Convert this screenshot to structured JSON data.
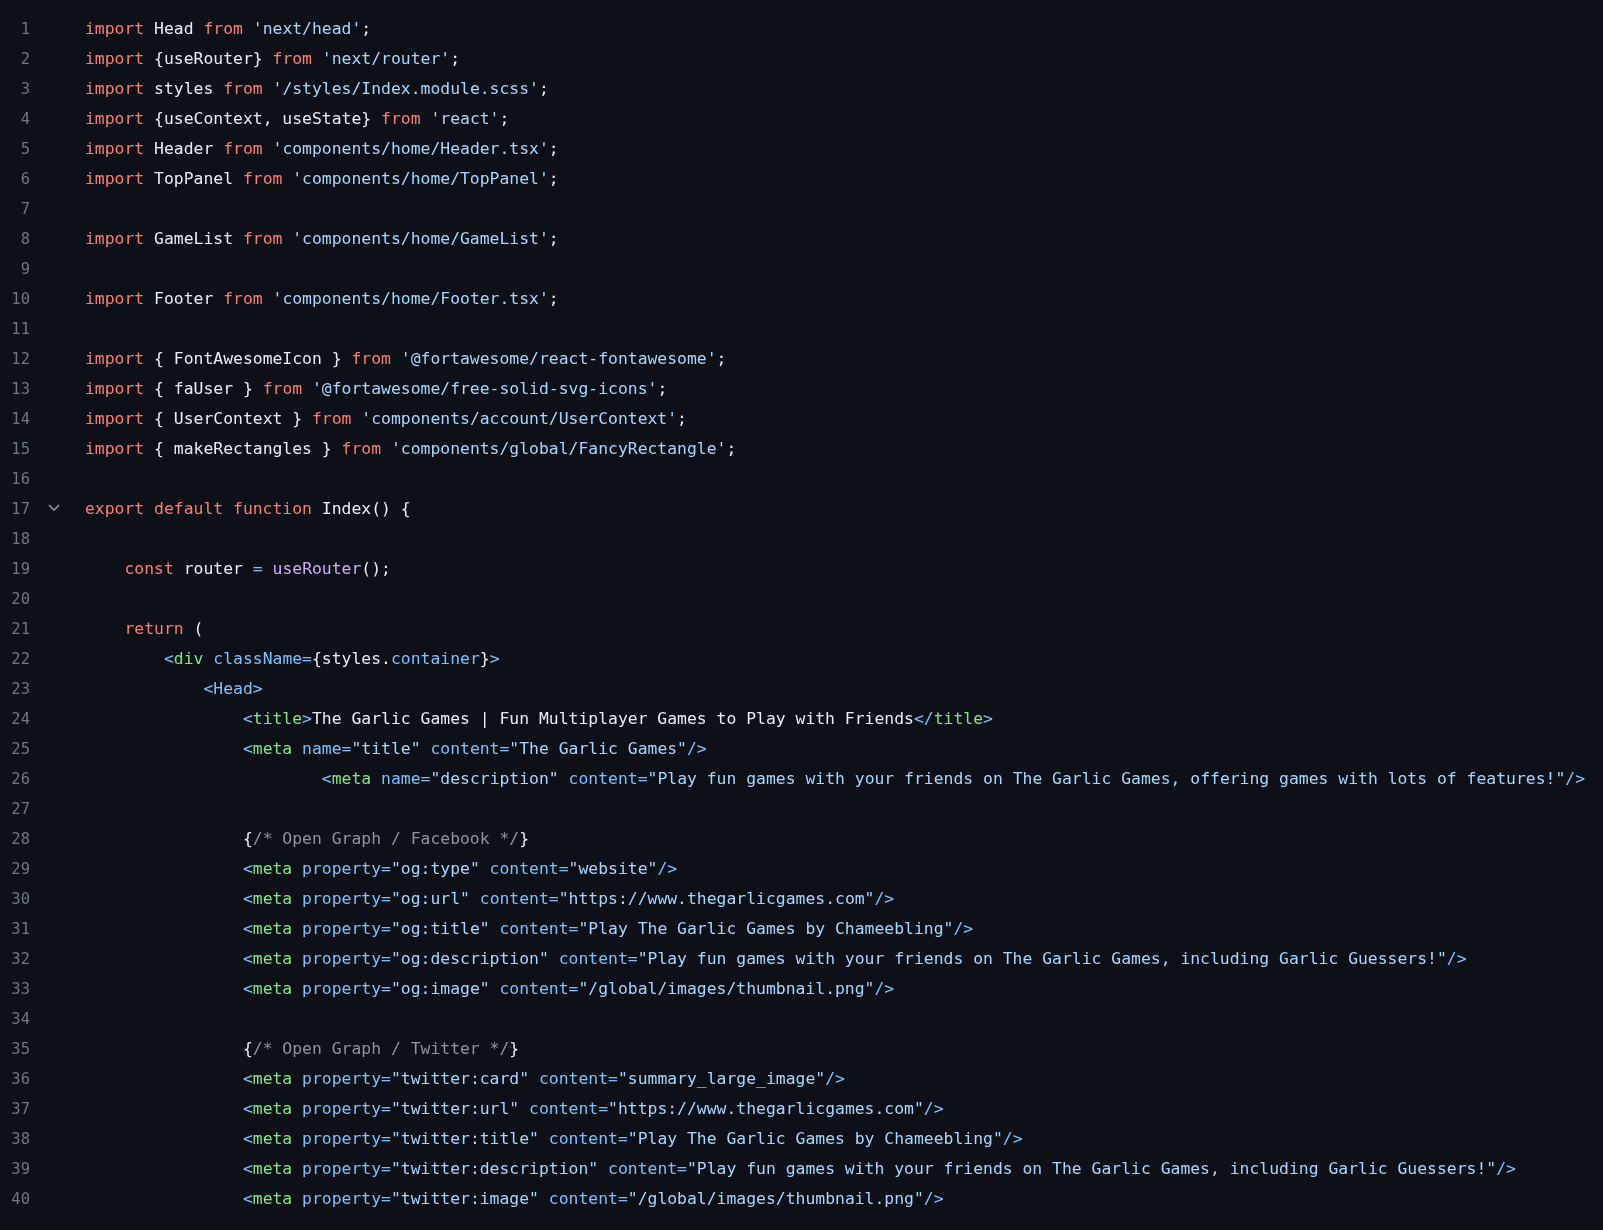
{
  "code_view": {
    "lines": [
      {
        "number": "1",
        "tokens": [
          {
            "kind": "keyword",
            "text": "import"
          },
          {
            "kind": "plain",
            "text": " Head "
          },
          {
            "kind": "keyword",
            "text": "from "
          },
          {
            "kind": "string",
            "text": "'next/head'"
          },
          {
            "kind": "plain",
            "text": ";"
          }
        ]
      },
      {
        "number": "2",
        "tokens": [
          {
            "kind": "keyword",
            "text": "import"
          },
          {
            "kind": "plain",
            "text": " {useRouter} "
          },
          {
            "kind": "keyword",
            "text": "from "
          },
          {
            "kind": "string",
            "text": "'next/router'"
          },
          {
            "kind": "plain",
            "text": ";"
          }
        ]
      },
      {
        "number": "3",
        "tokens": [
          {
            "kind": "keyword",
            "text": "import"
          },
          {
            "kind": "plain",
            "text": " styles "
          },
          {
            "kind": "keyword",
            "text": "from "
          },
          {
            "kind": "string",
            "text": "'/styles/Index.module.scss'"
          },
          {
            "kind": "plain",
            "text": ";"
          }
        ]
      },
      {
        "number": "4",
        "tokens": [
          {
            "kind": "keyword",
            "text": "import"
          },
          {
            "kind": "plain",
            "text": " {useContext, useState} "
          },
          {
            "kind": "keyword",
            "text": "from "
          },
          {
            "kind": "string",
            "text": "'react'"
          },
          {
            "kind": "plain",
            "text": ";"
          }
        ]
      },
      {
        "number": "5",
        "tokens": [
          {
            "kind": "keyword",
            "text": "import"
          },
          {
            "kind": "plain",
            "text": " Header "
          },
          {
            "kind": "keyword",
            "text": "from "
          },
          {
            "kind": "string",
            "text": "'components/home/Header.tsx'"
          },
          {
            "kind": "plain",
            "text": ";"
          }
        ]
      },
      {
        "number": "6",
        "tokens": [
          {
            "kind": "keyword",
            "text": "import"
          },
          {
            "kind": "plain",
            "text": " TopPanel "
          },
          {
            "kind": "keyword",
            "text": "from "
          },
          {
            "kind": "string",
            "text": "'components/home/TopPanel'"
          },
          {
            "kind": "plain",
            "text": ";"
          }
        ]
      },
      {
        "number": "7"
      },
      {
        "number": "8",
        "tokens": [
          {
            "kind": "keyword",
            "text": "import"
          },
          {
            "kind": "plain",
            "text": " GameList "
          },
          {
            "kind": "keyword",
            "text": "from "
          },
          {
            "kind": "string",
            "text": "'components/home/GameList'"
          },
          {
            "kind": "plain",
            "text": ";"
          }
        ]
      },
      {
        "number": "9"
      },
      {
        "number": "10",
        "tokens": [
          {
            "kind": "keyword",
            "text": "import"
          },
          {
            "kind": "plain",
            "text": " Footer "
          },
          {
            "kind": "keyword",
            "text": "from "
          },
          {
            "kind": "string",
            "text": "'components/home/Footer.tsx'"
          },
          {
            "kind": "plain",
            "text": ";"
          }
        ]
      },
      {
        "number": "11"
      },
      {
        "number": "12",
        "tokens": [
          {
            "kind": "keyword",
            "text": "import"
          },
          {
            "kind": "plain",
            "text": " { FontAwesomeIcon } "
          },
          {
            "kind": "keyword",
            "text": "from "
          },
          {
            "kind": "string",
            "text": "'@fortawesome/react-fontawesome'"
          },
          {
            "kind": "plain",
            "text": ";"
          }
        ]
      },
      {
        "number": "13",
        "tokens": [
          {
            "kind": "keyword",
            "text": "import"
          },
          {
            "kind": "plain",
            "text": " { faUser } "
          },
          {
            "kind": "keyword",
            "text": "from "
          },
          {
            "kind": "string",
            "text": "'@fortawesome/free-solid-svg-icons'"
          },
          {
            "kind": "plain",
            "text": ";"
          }
        ]
      },
      {
        "number": "14",
        "tokens": [
          {
            "kind": "keyword",
            "text": "import"
          },
          {
            "kind": "plain",
            "text": " { UserContext } "
          },
          {
            "kind": "keyword",
            "text": "from "
          },
          {
            "kind": "string",
            "text": "'components/account/UserContext'"
          },
          {
            "kind": "plain",
            "text": ";"
          }
        ]
      },
      {
        "number": "15",
        "tokens": [
          {
            "kind": "keyword",
            "text": "import"
          },
          {
            "kind": "plain",
            "text": " { makeRectangles } "
          },
          {
            "kind": "keyword",
            "text": "from "
          },
          {
            "kind": "string",
            "text": "'components/global/FancyRectangle'"
          },
          {
            "kind": "plain",
            "text": ";"
          }
        ]
      },
      {
        "number": "16"
      },
      {
        "number": "17",
        "expanded": true,
        "tokens": [
          {
            "kind": "keyword",
            "text": "export default function"
          },
          {
            "kind": "plain",
            "text": " Index() {"
          }
        ]
      },
      {
        "number": "18"
      },
      {
        "number": "19",
        "tokens": [
          {
            "kind": "keyword",
            "text": "    const"
          },
          {
            "kind": "plain",
            "text": " router "
          },
          {
            "kind": "attribute",
            "text": "= "
          },
          {
            "kind": "function",
            "text": "useRouter"
          },
          {
            "kind": "plain",
            "text": "();"
          }
        ]
      },
      {
        "number": "20"
      },
      {
        "number": "21",
        "tokens": [
          {
            "kind": "keyword",
            "text": "    return"
          },
          {
            "kind": "plain",
            "text": " ("
          }
        ]
      },
      {
        "number": "22",
        "tokens": [
          {
            "kind": "attribute",
            "text": "        <"
          },
          {
            "kind": "tag",
            "text": "div"
          },
          {
            "kind": "attribute",
            "text": " className="
          },
          {
            "kind": "plain",
            "text": "{styles."
          },
          {
            "kind": "attribute",
            "text": "container"
          },
          {
            "kind": "plain",
            "text": "}"
          },
          {
            "kind": "attribute",
            "text": ">"
          }
        ]
      },
      {
        "number": "23",
        "tokens": [
          {
            "kind": "attribute",
            "text": "            <Head>"
          }
        ]
      },
      {
        "number": "24",
        "tokens": [
          {
            "kind": "attribute",
            "text": "                <"
          },
          {
            "kind": "tag",
            "text": "title"
          },
          {
            "kind": "attribute",
            "text": ">"
          },
          {
            "kind": "plain",
            "text": "The Garlic Games | Fun Multiplayer Games to Play with Friends"
          },
          {
            "kind": "attribute",
            "text": "</"
          },
          {
            "kind": "tag",
            "text": "title"
          },
          {
            "kind": "attribute",
            "text": ">"
          }
        ]
      },
      {
        "number": "25",
        "tokens": [
          {
            "kind": "attribute",
            "text": "                <"
          },
          {
            "kind": "tag",
            "text": "meta"
          },
          {
            "kind": "attribute",
            "text": " name="
          },
          {
            "kind": "string",
            "text": "\"title\""
          },
          {
            "kind": "attribute",
            "text": " content="
          },
          {
            "kind": "string",
            "text": "\"The Garlic Games\""
          },
          {
            "kind": "attribute",
            "text": "/>"
          }
        ]
      },
      {
        "number": "26",
        "tokens": [
          {
            "kind": "attribute",
            "text": "                        <"
          },
          {
            "kind": "tag",
            "text": "meta"
          },
          {
            "kind": "attribute",
            "text": " name="
          },
          {
            "kind": "string",
            "text": "\"description\""
          },
          {
            "kind": "attribute",
            "text": " content="
          },
          {
            "kind": "string",
            "text": "\"Play fun games with your friends on The Garlic Games, offering games with lots of features!\""
          },
          {
            "kind": "attribute",
            "text": "/>"
          }
        ]
      },
      {
        "number": "27"
      },
      {
        "number": "28",
        "tokens": [
          {
            "kind": "plain",
            "text": "                {"
          },
          {
            "kind": "comment",
            "text": "/* Open Graph / Facebook */"
          },
          {
            "kind": "plain",
            "text": "}"
          }
        ]
      },
      {
        "number": "29",
        "tokens": [
          {
            "kind": "attribute",
            "text": "                <"
          },
          {
            "kind": "tag",
            "text": "meta"
          },
          {
            "kind": "attribute",
            "text": " property="
          },
          {
            "kind": "string",
            "text": "\"og:type\""
          },
          {
            "kind": "attribute",
            "text": " content="
          },
          {
            "kind": "string",
            "text": "\"website\""
          },
          {
            "kind": "attribute",
            "text": "/>"
          }
        ]
      },
      {
        "number": "30",
        "tokens": [
          {
            "kind": "attribute",
            "text": "                <"
          },
          {
            "kind": "tag",
            "text": "meta"
          },
          {
            "kind": "attribute",
            "text": " property="
          },
          {
            "kind": "string",
            "text": "\"og:url\""
          },
          {
            "kind": "attribute",
            "text": " content="
          },
          {
            "kind": "string",
            "text": "\"https://www.thegarlicgames.com\""
          },
          {
            "kind": "attribute",
            "text": "/>"
          }
        ]
      },
      {
        "number": "31",
        "tokens": [
          {
            "kind": "attribute",
            "text": "                <"
          },
          {
            "kind": "tag",
            "text": "meta"
          },
          {
            "kind": "attribute",
            "text": " property="
          },
          {
            "kind": "string",
            "text": "\"og:title\""
          },
          {
            "kind": "attribute",
            "text": " content="
          },
          {
            "kind": "string",
            "text": "\"Play The Garlic Games by Chameebling\""
          },
          {
            "kind": "attribute",
            "text": "/>"
          }
        ]
      },
      {
        "number": "32",
        "tokens": [
          {
            "kind": "attribute",
            "text": "                <"
          },
          {
            "kind": "tag",
            "text": "meta"
          },
          {
            "kind": "attribute",
            "text": " property="
          },
          {
            "kind": "string",
            "text": "\"og:description\""
          },
          {
            "kind": "attribute",
            "text": " content="
          },
          {
            "kind": "string",
            "text": "\"Play fun games with your friends on The Garlic Games, including Garlic Guessers!\""
          },
          {
            "kind": "attribute",
            "text": "/>"
          }
        ]
      },
      {
        "number": "33",
        "tokens": [
          {
            "kind": "attribute",
            "text": "                <"
          },
          {
            "kind": "tag",
            "text": "meta"
          },
          {
            "kind": "attribute",
            "text": " property="
          },
          {
            "kind": "string",
            "text": "\"og:image\""
          },
          {
            "kind": "attribute",
            "text": " content="
          },
          {
            "kind": "string",
            "text": "\"/global/images/thumbnail.png\""
          },
          {
            "kind": "attribute",
            "text": "/>"
          }
        ]
      },
      {
        "number": "34"
      },
      {
        "number": "35",
        "tokens": [
          {
            "kind": "plain",
            "text": "                {"
          },
          {
            "kind": "comment",
            "text": "/* Open Graph / Twitter */"
          },
          {
            "kind": "plain",
            "text": "}"
          }
        ]
      },
      {
        "number": "36",
        "tokens": [
          {
            "kind": "attribute",
            "text": "                <"
          },
          {
            "kind": "tag",
            "text": "meta"
          },
          {
            "kind": "attribute",
            "text": " property="
          },
          {
            "kind": "string",
            "text": "\"twitter:card\""
          },
          {
            "kind": "attribute",
            "text": " content="
          },
          {
            "kind": "string",
            "text": "\"summary_large_image\""
          },
          {
            "kind": "attribute",
            "text": "/>"
          }
        ]
      },
      {
        "number": "37",
        "tokens": [
          {
            "kind": "attribute",
            "text": "                <"
          },
          {
            "kind": "tag",
            "text": "meta"
          },
          {
            "kind": "attribute",
            "text": " property="
          },
          {
            "kind": "string",
            "text": "\"twitter:url\""
          },
          {
            "kind": "attribute",
            "text": " content="
          },
          {
            "kind": "string",
            "text": "\"https://www.thegarlicgames.com\""
          },
          {
            "kind": "attribute",
            "text": "/>"
          }
        ]
      },
      {
        "number": "38",
        "tokens": [
          {
            "kind": "attribute",
            "text": "                <"
          },
          {
            "kind": "tag",
            "text": "meta"
          },
          {
            "kind": "attribute",
            "text": " property="
          },
          {
            "kind": "string",
            "text": "\"twitter:title\""
          },
          {
            "kind": "attribute",
            "text": " content="
          },
          {
            "kind": "string",
            "text": "\"Play The Garlic Games by Chameebling\""
          },
          {
            "kind": "attribute",
            "text": "/>"
          }
        ]
      },
      {
        "number": "39",
        "tokens": [
          {
            "kind": "attribute",
            "text": "                <"
          },
          {
            "kind": "tag",
            "text": "meta"
          },
          {
            "kind": "attribute",
            "text": " property="
          },
          {
            "kind": "string",
            "text": "\"twitter:description\""
          },
          {
            "kind": "attribute",
            "text": " content="
          },
          {
            "kind": "string",
            "text": "\"Play fun games with your friends on The Garlic Games, including Garlic Guessers!\""
          },
          {
            "kind": "attribute",
            "text": "/>"
          }
        ]
      },
      {
        "number": "40",
        "tokens": [
          {
            "kind": "attribute",
            "text": "                <"
          },
          {
            "kind": "tag",
            "text": "meta"
          },
          {
            "kind": "attribute",
            "text": " property="
          },
          {
            "kind": "string",
            "text": "\"twitter:image\""
          },
          {
            "kind": "attribute",
            "text": " content="
          },
          {
            "kind": "string",
            "text": "\"/global/images/thumbnail.png\""
          },
          {
            "kind": "attribute",
            "text": "/>"
          }
        ]
      }
    ]
  }
}
